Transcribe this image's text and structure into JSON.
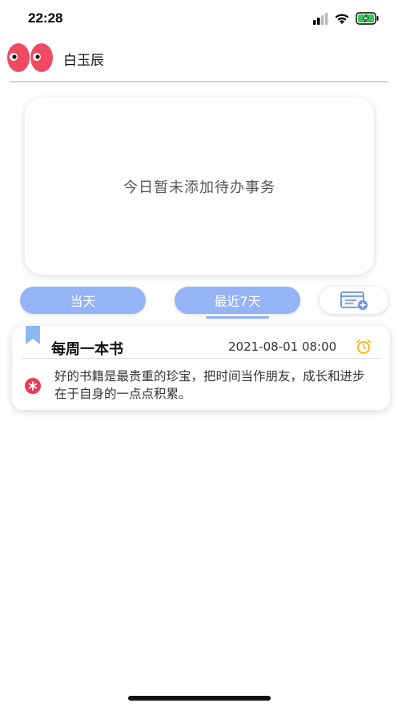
{
  "status_bar": {
    "time": "22:28",
    "signal_icon": "cellular-signal-icon",
    "wifi_icon": "wifi-icon",
    "battery_icon": "battery-charging-icon"
  },
  "header": {
    "avatar_icon": "eyes-avatar-icon",
    "user_name": "白玉辰"
  },
  "empty_state": {
    "message": "今日暂未添加待办事务"
  },
  "tabs": [
    {
      "label": "当天",
      "active": false
    },
    {
      "label": "最近7天",
      "active": true
    }
  ],
  "add_button": {
    "icon": "add-task-icon"
  },
  "task": {
    "title": "每周一本书",
    "datetime": "2021-08-01 08:00",
    "description": "好的书籍是最贵重的珍宝，把时间当作朋友，成长和进步在于自身的一点点积累。",
    "bookmark_icon": "bookmark-icon",
    "alarm_icon": "alarm-clock-icon",
    "priority_icon": "asterisk-icon"
  },
  "colors": {
    "accent_blue": "#95b3f7",
    "avatar_red": "#f04a63",
    "alarm_yellow": "#f5b400",
    "priority_red": "#ea3a5a",
    "bookmark_blue": "#8ab8f0",
    "battery_green": "#34c759"
  }
}
